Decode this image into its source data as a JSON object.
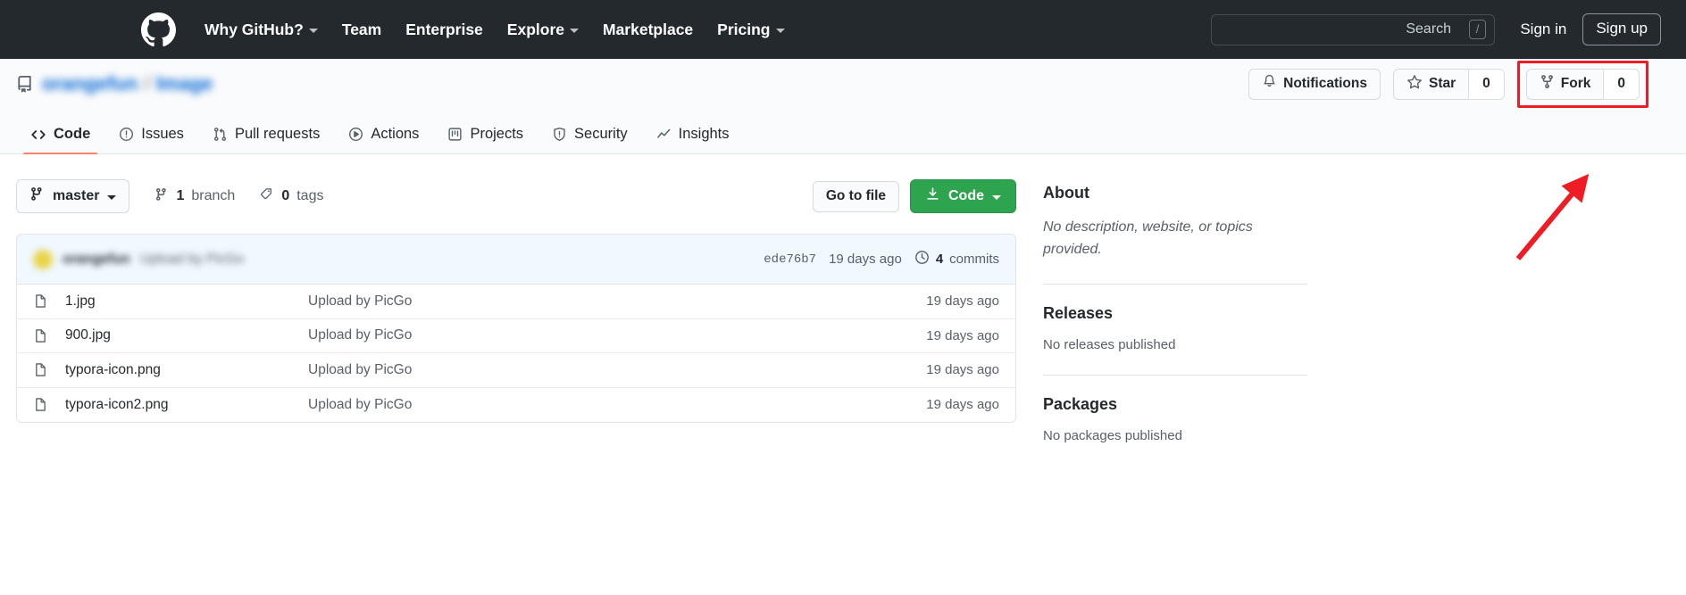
{
  "global_header": {
    "logo_icon": "github-mark-icon",
    "nav": [
      {
        "label": "Why GitHub?",
        "has_caret": true
      },
      {
        "label": "Team",
        "has_caret": false
      },
      {
        "label": "Enterprise",
        "has_caret": false
      },
      {
        "label": "Explore",
        "has_caret": true
      },
      {
        "label": "Marketplace",
        "has_caret": false
      },
      {
        "label": "Pricing",
        "has_caret": true
      }
    ],
    "search": {
      "placeholder": "Search",
      "value": "",
      "shortcut_key": "/"
    },
    "sign_in_label": "Sign in",
    "sign_up_label": "Sign up"
  },
  "repo": {
    "icon": "repo-icon",
    "owner": "orangefun",
    "separator": "/",
    "name": "Image",
    "actions": {
      "notifications_label": "Notifications",
      "star_label": "Star",
      "star_count": "0",
      "fork_label": "Fork",
      "fork_count": "0"
    },
    "tabs": [
      {
        "label": "Code",
        "icon": "code-icon",
        "active": true
      },
      {
        "label": "Issues",
        "icon": "issue-opened-icon",
        "active": false
      },
      {
        "label": "Pull requests",
        "icon": "git-pull-request-icon",
        "active": false
      },
      {
        "label": "Actions",
        "icon": "play-icon",
        "active": false
      },
      {
        "label": "Projects",
        "icon": "project-icon",
        "active": false
      },
      {
        "label": "Security",
        "icon": "shield-icon",
        "active": false
      },
      {
        "label": "Insights",
        "icon": "graph-icon",
        "active": false
      }
    ]
  },
  "code_toolbar": {
    "branch_name": "master",
    "branch_count_number": "1",
    "branch_count_label": "branch",
    "tag_count_number": "0",
    "tag_count_label": "tags",
    "go_to_file_label": "Go to file",
    "code_button_label": "Code"
  },
  "latest_commit": {
    "author": "orangefun",
    "message": "Upload by PicGo",
    "sha": "ede76b7",
    "time": "19 days ago",
    "commits_count": "4",
    "commits_label": "commits"
  },
  "files": [
    {
      "name": "1.jpg",
      "message": "Upload by PicGo",
      "time": "19 days ago"
    },
    {
      "name": "900.jpg",
      "message": "Upload by PicGo",
      "time": "19 days ago"
    },
    {
      "name": "typora-icon.png",
      "message": "Upload by PicGo",
      "time": "19 days ago"
    },
    {
      "name": "typora-icon2.png",
      "message": "Upload by PicGo",
      "time": "19 days ago"
    }
  ],
  "sidebar": {
    "about_title": "About",
    "about_text": "No description, website, or topics provided.",
    "releases_title": "Releases",
    "releases_empty": "No releases published",
    "packages_title": "Packages",
    "packages_empty": "No packages published"
  },
  "annotation": {
    "highlight_target": "fork-button",
    "color": "#ee1c25",
    "arrow": "red-arrow-pointing-to-fork"
  }
}
